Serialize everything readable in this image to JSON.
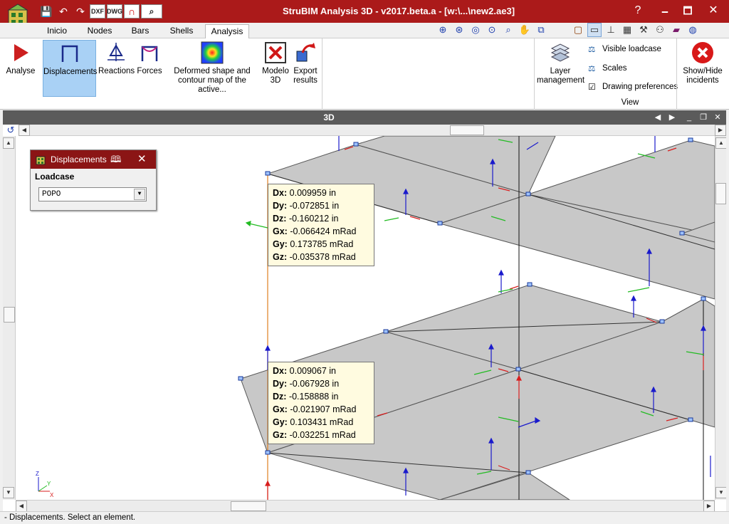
{
  "window": {
    "title": "StruBIM Analysis 3D - v2017.beta.a - [w:\\...\\new2.ae3]",
    "help_glyph": "?",
    "minimize_glyph": "🗕",
    "maximize_glyph": "🗖",
    "close_glyph": "✕"
  },
  "quick_access": [
    {
      "name": "save-icon",
      "glyph": "💾"
    },
    {
      "name": "undo-icon",
      "glyph": "↶"
    },
    {
      "name": "redo-icon",
      "glyph": "↷"
    },
    {
      "name": "dxf-export-icon",
      "glyph": "DXF"
    },
    {
      "name": "dwg-export-icon",
      "glyph": "DWG"
    },
    {
      "name": "magnet-icon",
      "glyph": "∩"
    },
    {
      "name": "zoom-dropdown-icon",
      "glyph": "⌕"
    }
  ],
  "tabs": [
    "Inicio",
    "Nodes",
    "Bars",
    "Shells",
    "Analysis"
  ],
  "ribbon": {
    "analyse": "Analyse",
    "displacements": "Displacements",
    "reactions": "Reactions",
    "forces": "Forces",
    "deformed_line1": "Deformed shape and",
    "deformed_line2": "contour map of the active...",
    "modelo_line1": "Modelo",
    "modelo_line2": "3D",
    "export_line1": "Export",
    "export_line2": "results",
    "layer_line1": "Layer",
    "layer_line2": "management",
    "visible_loadcase": "Visible loadcase",
    "scales": "Scales",
    "drawing_preferences": "Drawing preferences",
    "show_hide_line1": "Show/Hide",
    "show_hide_line2": "incidents",
    "group_view": "View"
  },
  "view": {
    "title": "3D",
    "prev_glyph": "◀",
    "next_glyph": "▶",
    "minimize_glyph": "_",
    "restore_glyph": "❐",
    "close_glyph": "✕"
  },
  "panel": {
    "title": "Displacements",
    "loadcase_label": "Loadcase",
    "loadcase_value": "POPO"
  },
  "tooltips": [
    {
      "dx_label": "Dx:",
      "dx": "0.009959 in",
      "dy_label": "Dy:",
      "dy": "-0.072851 in",
      "dz_label": "Dz:",
      "dz": "-0.160212 in",
      "gx_label": "Gx:",
      "gx": "-0.066424 mRad",
      "gy_label": "Gy:",
      "gy": "0.173785 mRad",
      "gz_label": "Gz:",
      "gz": "-0.035378 mRad"
    },
    {
      "dx_label": "Dx:",
      "dx": "0.009067 in",
      "dy_label": "Dy:",
      "dy": "-0.067928 in",
      "dz_label": "Dz:",
      "dz": "-0.158888 in",
      "gx_label": "Gx:",
      "gx": "-0.021907 mRad",
      "gy_label": "Gy:",
      "gy": "0.103431 mRad",
      "gz_label": "Gz:",
      "gz": "-0.032251 mRad"
    }
  ],
  "axes": {
    "z": "Z",
    "x": "X",
    "y": "Y"
  },
  "status": "- Displacements.  Select an element.",
  "colors": {
    "title_bar": "#ab1a1a",
    "panel_header": "#8b1515",
    "active_button": "#a9d1f5",
    "shell_fill": "#c8c8c8",
    "vector_blue": "#1a1acc",
    "vector_red": "#d81e1e",
    "vector_green": "#22bb22"
  }
}
